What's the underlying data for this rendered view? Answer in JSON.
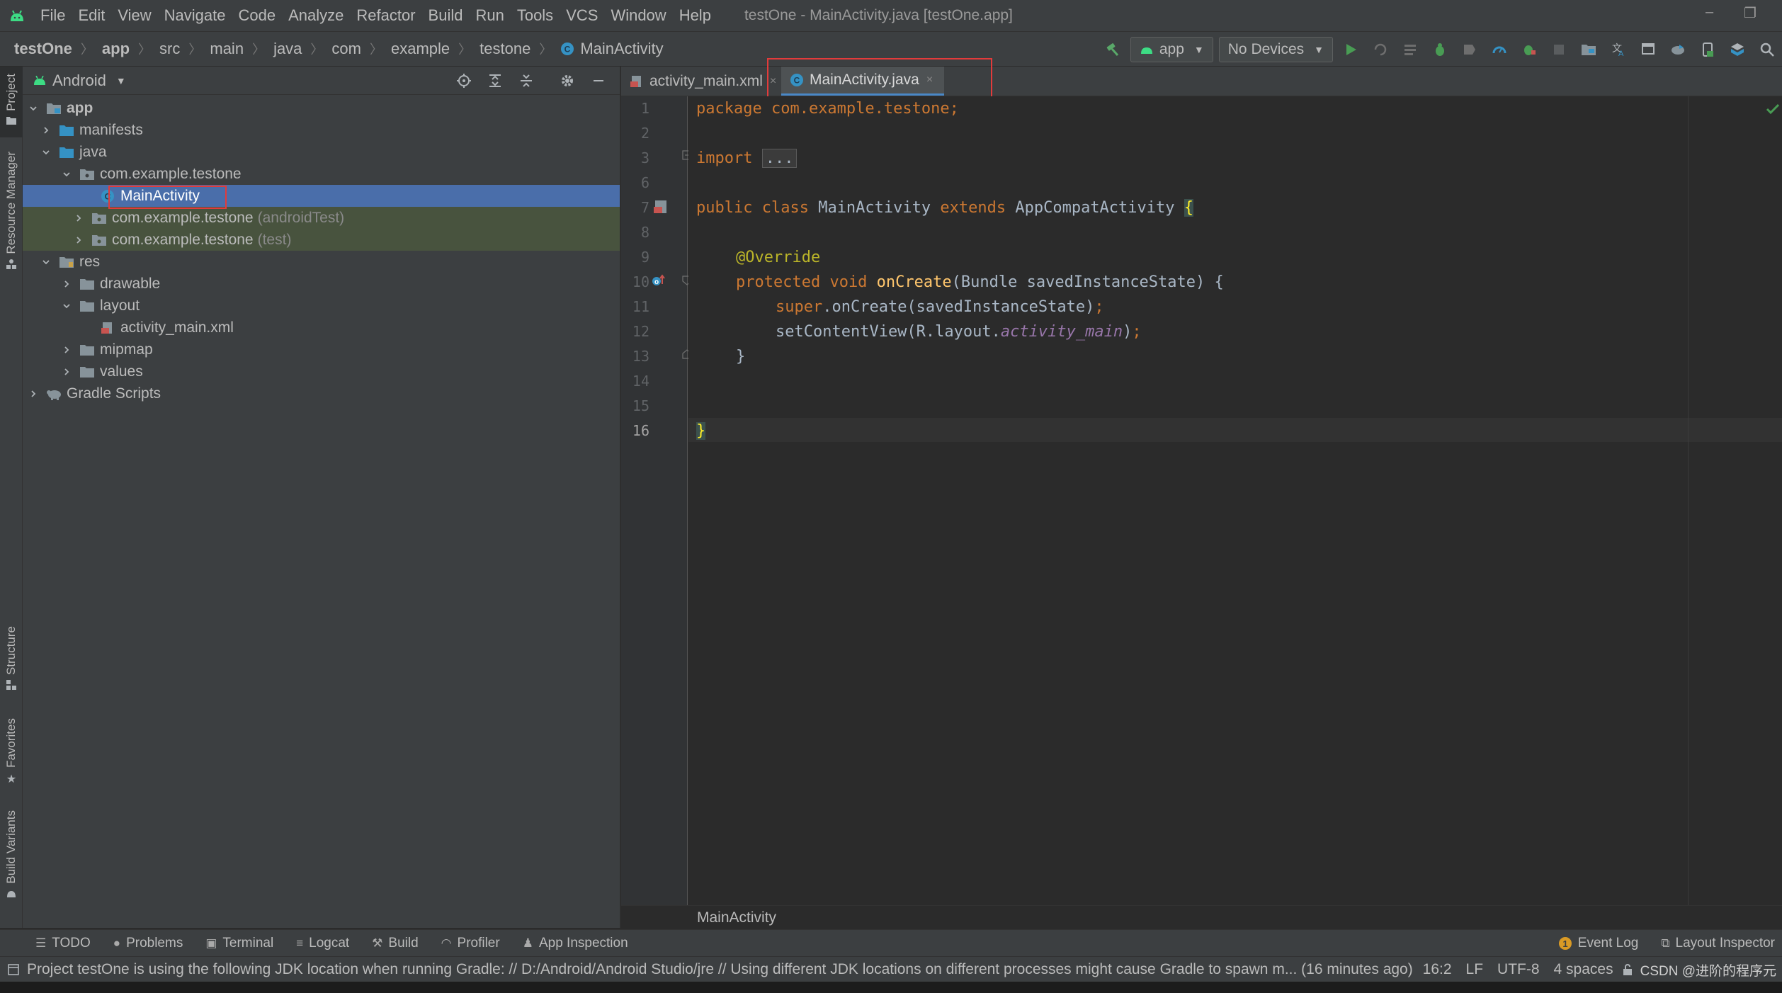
{
  "window": {
    "title": "testOne - MainActivity.java [testOne.app]",
    "menu": [
      "File",
      "Edit",
      "View",
      "Navigate",
      "Code",
      "Analyze",
      "Refactor",
      "Build",
      "Run",
      "Tools",
      "VCS",
      "Window",
      "Help"
    ],
    "minimize": "–",
    "restore": "❐"
  },
  "breadcrumb": [
    "testOne",
    "app",
    "src",
    "main",
    "java",
    "com",
    "example",
    "testone",
    "MainActivity"
  ],
  "toolbar": {
    "run_config": "app",
    "device": "No Devices"
  },
  "left_strip": {
    "tabs": [
      "Project",
      "Resource Manager",
      "Structure",
      "Favorites",
      "Build Variants"
    ]
  },
  "project_panel": {
    "view": "Android",
    "tree": [
      {
        "label": "app",
        "suffix": ""
      },
      {
        "label": "manifests",
        "suffix": ""
      },
      {
        "label": "java",
        "suffix": ""
      },
      {
        "label": "com.example.testone",
        "suffix": ""
      },
      {
        "label": "MainActivity",
        "suffix": ""
      },
      {
        "label": "com.example.testone",
        "suffix": "(androidTest)"
      },
      {
        "label": "com.example.testone",
        "suffix": "(test)"
      },
      {
        "label": "res",
        "suffix": ""
      },
      {
        "label": "drawable",
        "suffix": ""
      },
      {
        "label": "layout",
        "suffix": ""
      },
      {
        "label": "activity_main.xml",
        "suffix": ""
      },
      {
        "label": "mipmap",
        "suffix": ""
      },
      {
        "label": "values",
        "suffix": ""
      },
      {
        "label": "Gradle Scripts",
        "suffix": ""
      }
    ]
  },
  "editor": {
    "tabs": [
      {
        "label": "activity_main.xml",
        "close": "×"
      },
      {
        "label": "MainActivity.java",
        "close": "×"
      }
    ],
    "line_numbers": [
      "1",
      "2",
      "3",
      "6",
      "7",
      "8",
      "9",
      "10",
      "11",
      "12",
      "13",
      "14",
      "15",
      "16"
    ],
    "code": {
      "l1_kw": "package",
      "l1_rest": " com.example.testone;",
      "l3_kw": "import",
      "l3_fold": "...",
      "l7_a": "public class",
      "l7_b": " MainActivity ",
      "l7_c": "extends",
      "l7_d": " AppCompatActivity ",
      "l7_brace": "{",
      "l9_ann": "@Override",
      "l10_kw": "protected void",
      "l10_fn": " onCreate",
      "l10_rest": "(Bundle savedInstanceState) {",
      "l11_kw": "super",
      "l11_rest": ".onCreate(savedInstanceState)",
      "l11_semi": ";",
      "l12_a": "setContentView(R.layout.",
      "l12_fld": "activity_main",
      "l12_b": ")",
      "l12_semi": ";",
      "l13": "}",
      "l16": "}"
    },
    "breadcrumb": "MainActivity"
  },
  "bottom_tools": [
    "TODO",
    "Problems",
    "Terminal",
    "Logcat",
    "Build",
    "Profiler",
    "App Inspection"
  ],
  "bottom_tools_right": [
    "Event Log",
    "Layout Inspector"
  ],
  "status": {
    "message": "Project testOne is using the following JDK location when running Gradle: // D:/Android/Android Studio/jre // Using different JDK locations on different processes might cause Gradle to spawn m... (16 minutes ago)",
    "position": "16:2",
    "line_sep": "LF",
    "encoding": "UTF-8",
    "indent": "4 spaces",
    "watermark": "CSDN @进阶的程序元"
  },
  "colors": {
    "accent": "#4a88c7",
    "selection": "#4a6eaa",
    "highlight_box": "#e23b3b",
    "android_green": "#3ddc84"
  }
}
